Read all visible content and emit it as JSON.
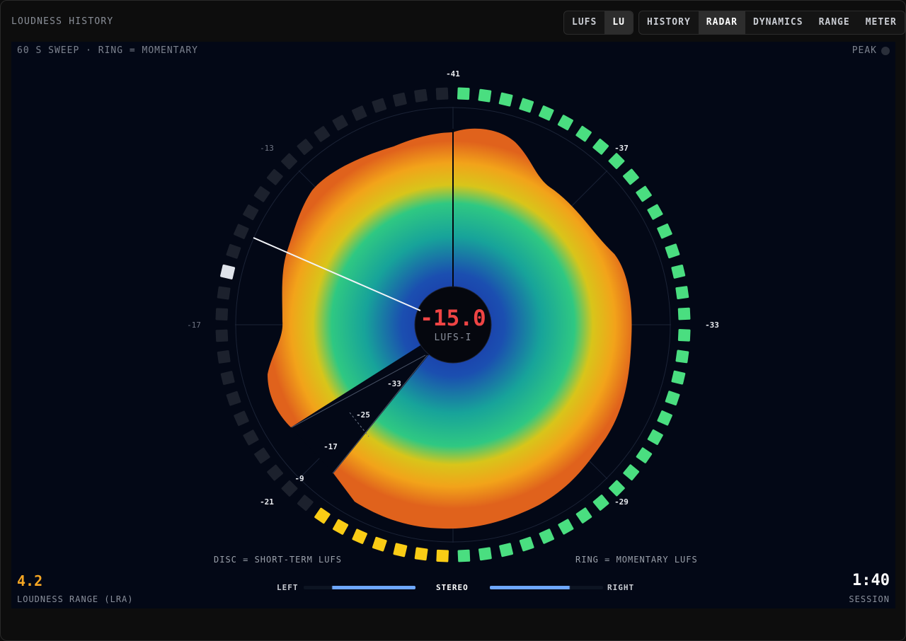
{
  "app": {
    "title": "LOUDNESS HISTORY"
  },
  "units": {
    "items": [
      "LUFS",
      "LU"
    ],
    "active": "LU"
  },
  "views": {
    "items": [
      "HISTORY",
      "RADAR",
      "DYNAMICS",
      "RANGE",
      "METER"
    ],
    "active": "RADAR"
  },
  "radar": {
    "subtitle": "60 S SWEEP · RING = MOMENTARY",
    "peak_label": "PEAK",
    "center_value": "-15.0",
    "center_unit": "LUFS-I",
    "disc_label": "DISC = SHORT-TERM LUFS",
    "ring_label": "RING = MOMENTARY LUFS",
    "outer_labels": {
      "top": "-41",
      "top_right": "-37",
      "right": "-33",
      "bottom_right": "-29",
      "bottom_left": "-21",
      "left": "-17",
      "top_left": "-13"
    },
    "inner_scale": [
      "-33",
      "-25",
      "-17",
      "-9"
    ],
    "ring_colors": {
      "green": "#4ade80",
      "yellow": "#facc15",
      "dim": "#1c212d",
      "peak": "#dfe3ea"
    }
  },
  "stats": {
    "lra_value": "4.2",
    "lra_label": "LOUDNESS RANGE (LRA)",
    "session_value": "1:40",
    "session_label": "SESSION"
  },
  "stereo": {
    "left": "LEFT",
    "center": "STEREO",
    "right": "RIGHT",
    "left_level": 0.75,
    "right_level": 0.7
  },
  "colors": {
    "accent_red": "#ef4444",
    "lra": "#f5a623",
    "stereo_bar": "#6ea7ff"
  }
}
